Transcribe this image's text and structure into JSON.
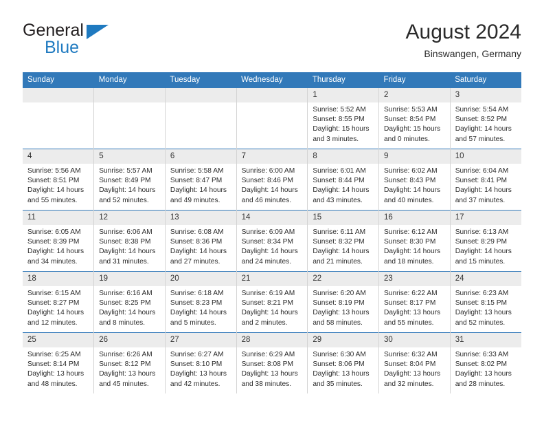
{
  "brand": {
    "name_top": "General",
    "name_bottom": "Blue",
    "triangle_color": "#1f7ac0",
    "text_color": "#231f20"
  },
  "header": {
    "title": "August 2024",
    "subtitle": "Binswangen, Germany"
  },
  "colors": {
    "header_bar": "#3279b9",
    "daynum_band": "#ececec",
    "cell_border": "#d4d4d4",
    "row_separator": "#3279b9",
    "text": "#2b2b2b"
  },
  "calendar": {
    "weekday_headers": [
      "Sunday",
      "Monday",
      "Tuesday",
      "Wednesday",
      "Thursday",
      "Friday",
      "Saturday"
    ],
    "weeks": [
      [
        {
          "day": "",
          "sunrise": "",
          "sunset": "",
          "daylight_1": "",
          "daylight_2": ""
        },
        {
          "day": "",
          "sunrise": "",
          "sunset": "",
          "daylight_1": "",
          "daylight_2": ""
        },
        {
          "day": "",
          "sunrise": "",
          "sunset": "",
          "daylight_1": "",
          "daylight_2": ""
        },
        {
          "day": "",
          "sunrise": "",
          "sunset": "",
          "daylight_1": "",
          "daylight_2": ""
        },
        {
          "day": "1",
          "sunrise": "Sunrise: 5:52 AM",
          "sunset": "Sunset: 8:55 PM",
          "daylight_1": "Daylight: 15 hours",
          "daylight_2": "and 3 minutes."
        },
        {
          "day": "2",
          "sunrise": "Sunrise: 5:53 AM",
          "sunset": "Sunset: 8:54 PM",
          "daylight_1": "Daylight: 15 hours",
          "daylight_2": "and 0 minutes."
        },
        {
          "day": "3",
          "sunrise": "Sunrise: 5:54 AM",
          "sunset": "Sunset: 8:52 PM",
          "daylight_1": "Daylight: 14 hours",
          "daylight_2": "and 57 minutes."
        }
      ],
      [
        {
          "day": "4",
          "sunrise": "Sunrise: 5:56 AM",
          "sunset": "Sunset: 8:51 PM",
          "daylight_1": "Daylight: 14 hours",
          "daylight_2": "and 55 minutes."
        },
        {
          "day": "5",
          "sunrise": "Sunrise: 5:57 AM",
          "sunset": "Sunset: 8:49 PM",
          "daylight_1": "Daylight: 14 hours",
          "daylight_2": "and 52 minutes."
        },
        {
          "day": "6",
          "sunrise": "Sunrise: 5:58 AM",
          "sunset": "Sunset: 8:47 PM",
          "daylight_1": "Daylight: 14 hours",
          "daylight_2": "and 49 minutes."
        },
        {
          "day": "7",
          "sunrise": "Sunrise: 6:00 AM",
          "sunset": "Sunset: 8:46 PM",
          "daylight_1": "Daylight: 14 hours",
          "daylight_2": "and 46 minutes."
        },
        {
          "day": "8",
          "sunrise": "Sunrise: 6:01 AM",
          "sunset": "Sunset: 8:44 PM",
          "daylight_1": "Daylight: 14 hours",
          "daylight_2": "and 43 minutes."
        },
        {
          "day": "9",
          "sunrise": "Sunrise: 6:02 AM",
          "sunset": "Sunset: 8:43 PM",
          "daylight_1": "Daylight: 14 hours",
          "daylight_2": "and 40 minutes."
        },
        {
          "day": "10",
          "sunrise": "Sunrise: 6:04 AM",
          "sunset": "Sunset: 8:41 PM",
          "daylight_1": "Daylight: 14 hours",
          "daylight_2": "and 37 minutes."
        }
      ],
      [
        {
          "day": "11",
          "sunrise": "Sunrise: 6:05 AM",
          "sunset": "Sunset: 8:39 PM",
          "daylight_1": "Daylight: 14 hours",
          "daylight_2": "and 34 minutes."
        },
        {
          "day": "12",
          "sunrise": "Sunrise: 6:06 AM",
          "sunset": "Sunset: 8:38 PM",
          "daylight_1": "Daylight: 14 hours",
          "daylight_2": "and 31 minutes."
        },
        {
          "day": "13",
          "sunrise": "Sunrise: 6:08 AM",
          "sunset": "Sunset: 8:36 PM",
          "daylight_1": "Daylight: 14 hours",
          "daylight_2": "and 27 minutes."
        },
        {
          "day": "14",
          "sunrise": "Sunrise: 6:09 AM",
          "sunset": "Sunset: 8:34 PM",
          "daylight_1": "Daylight: 14 hours",
          "daylight_2": "and 24 minutes."
        },
        {
          "day": "15",
          "sunrise": "Sunrise: 6:11 AM",
          "sunset": "Sunset: 8:32 PM",
          "daylight_1": "Daylight: 14 hours",
          "daylight_2": "and 21 minutes."
        },
        {
          "day": "16",
          "sunrise": "Sunrise: 6:12 AM",
          "sunset": "Sunset: 8:30 PM",
          "daylight_1": "Daylight: 14 hours",
          "daylight_2": "and 18 minutes."
        },
        {
          "day": "17",
          "sunrise": "Sunrise: 6:13 AM",
          "sunset": "Sunset: 8:29 PM",
          "daylight_1": "Daylight: 14 hours",
          "daylight_2": "and 15 minutes."
        }
      ],
      [
        {
          "day": "18",
          "sunrise": "Sunrise: 6:15 AM",
          "sunset": "Sunset: 8:27 PM",
          "daylight_1": "Daylight: 14 hours",
          "daylight_2": "and 12 minutes."
        },
        {
          "day": "19",
          "sunrise": "Sunrise: 6:16 AM",
          "sunset": "Sunset: 8:25 PM",
          "daylight_1": "Daylight: 14 hours",
          "daylight_2": "and 8 minutes."
        },
        {
          "day": "20",
          "sunrise": "Sunrise: 6:18 AM",
          "sunset": "Sunset: 8:23 PM",
          "daylight_1": "Daylight: 14 hours",
          "daylight_2": "and 5 minutes."
        },
        {
          "day": "21",
          "sunrise": "Sunrise: 6:19 AM",
          "sunset": "Sunset: 8:21 PM",
          "daylight_1": "Daylight: 14 hours",
          "daylight_2": "and 2 minutes."
        },
        {
          "day": "22",
          "sunrise": "Sunrise: 6:20 AM",
          "sunset": "Sunset: 8:19 PM",
          "daylight_1": "Daylight: 13 hours",
          "daylight_2": "and 58 minutes."
        },
        {
          "day": "23",
          "sunrise": "Sunrise: 6:22 AM",
          "sunset": "Sunset: 8:17 PM",
          "daylight_1": "Daylight: 13 hours",
          "daylight_2": "and 55 minutes."
        },
        {
          "day": "24",
          "sunrise": "Sunrise: 6:23 AM",
          "sunset": "Sunset: 8:15 PM",
          "daylight_1": "Daylight: 13 hours",
          "daylight_2": "and 52 minutes."
        }
      ],
      [
        {
          "day": "25",
          "sunrise": "Sunrise: 6:25 AM",
          "sunset": "Sunset: 8:14 PM",
          "daylight_1": "Daylight: 13 hours",
          "daylight_2": "and 48 minutes."
        },
        {
          "day": "26",
          "sunrise": "Sunrise: 6:26 AM",
          "sunset": "Sunset: 8:12 PM",
          "daylight_1": "Daylight: 13 hours",
          "daylight_2": "and 45 minutes."
        },
        {
          "day": "27",
          "sunrise": "Sunrise: 6:27 AM",
          "sunset": "Sunset: 8:10 PM",
          "daylight_1": "Daylight: 13 hours",
          "daylight_2": "and 42 minutes."
        },
        {
          "day": "28",
          "sunrise": "Sunrise: 6:29 AM",
          "sunset": "Sunset: 8:08 PM",
          "daylight_1": "Daylight: 13 hours",
          "daylight_2": "and 38 minutes."
        },
        {
          "day": "29",
          "sunrise": "Sunrise: 6:30 AM",
          "sunset": "Sunset: 8:06 PM",
          "daylight_1": "Daylight: 13 hours",
          "daylight_2": "and 35 minutes."
        },
        {
          "day": "30",
          "sunrise": "Sunrise: 6:32 AM",
          "sunset": "Sunset: 8:04 PM",
          "daylight_1": "Daylight: 13 hours",
          "daylight_2": "and 32 minutes."
        },
        {
          "day": "31",
          "sunrise": "Sunrise: 6:33 AM",
          "sunset": "Sunset: 8:02 PM",
          "daylight_1": "Daylight: 13 hours",
          "daylight_2": "and 28 minutes."
        }
      ]
    ]
  }
}
